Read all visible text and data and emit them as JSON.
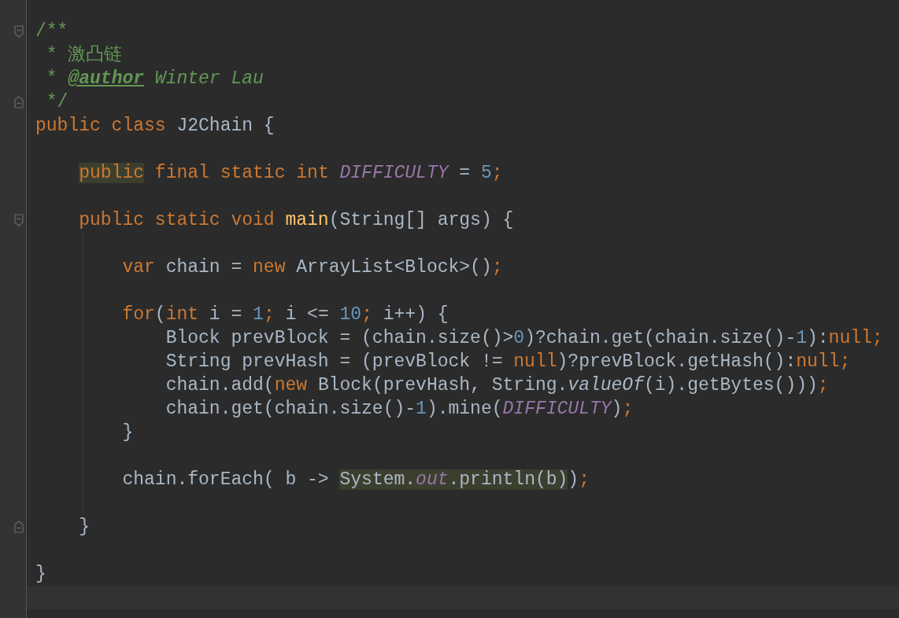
{
  "editor": {
    "current_line_highlight": true,
    "blocks": [
      {
        "lines": [
          {
            "fold_start": true,
            "tokens": [
              {
                "text": "/**",
                "kind": "comment"
              }
            ]
          },
          {
            "tokens": [
              {
                "text": " * 激凸链",
                "kind": "comment"
              }
            ]
          },
          {
            "tokens": [
              {
                "text": " * ",
                "kind": "comment"
              },
              {
                "text": "@author",
                "kind": "doctag"
              },
              {
                "text": " Winter Lau",
                "kind": "commentitalic"
              }
            ]
          },
          {
            "fold_end": true,
            "tokens": [
              {
                "text": " */",
                "kind": "comment"
              }
            ]
          },
          {
            "tokens": [
              {
                "text": "public class ",
                "kind": "keyword"
              },
              {
                "text": "J2Chain {",
                "kind": "plain"
              }
            ]
          }
        ]
      },
      {
        "lines": [
          {
            "tokens": [
              {
                "text": "    public",
                "kind": "keyword",
                "highlighted": true
              },
              {
                "text": " final static int ",
                "kind": "keyword"
              },
              {
                "text": "DIFFICULTY",
                "kind": "constant"
              },
              {
                "text": " = ",
                "kind": "plain"
              },
              {
                "text": "5",
                "kind": "number"
              },
              {
                "text": ";",
                "kind": "keyword"
              }
            ]
          }
        ]
      },
      {
        "lines": [
          {
            "fold_start": true,
            "tokens": [
              {
                "text": "    public static void ",
                "kind": "keyword"
              },
              {
                "text": "main",
                "kind": "function"
              },
              {
                "text": "(String[] args) {",
                "kind": "plain"
              }
            ]
          }
        ]
      },
      {
        "lines": [
          {
            "tokens": [
              {
                "text": "        var ",
                "kind": "keyword"
              },
              {
                "text": "chain = ",
                "kind": "plain"
              },
              {
                "text": "new ",
                "kind": "keyword"
              },
              {
                "text": "ArrayList<Block>()",
                "kind": "plain"
              },
              {
                "text": ";",
                "kind": "keyword"
              }
            ]
          }
        ]
      },
      {
        "lines": [
          {
            "tokens": [
              {
                "text": "        for",
                "kind": "keyword"
              },
              {
                "text": "(",
                "kind": "plain"
              },
              {
                "text": "int ",
                "kind": "keyword"
              },
              {
                "text": "i = ",
                "kind": "plain"
              },
              {
                "text": "1",
                "kind": "number"
              },
              {
                "text": "; ",
                "kind": "keyword"
              },
              {
                "text": "i <= ",
                "kind": "plain"
              },
              {
                "text": "10",
                "kind": "number"
              },
              {
                "text": "; ",
                "kind": "keyword"
              },
              {
                "text": "i++) {",
                "kind": "plain"
              }
            ]
          },
          {
            "tokens": [
              {
                "text": "            Block prevBlock = (chain.size()>",
                "kind": "plain"
              },
              {
                "text": "0",
                "kind": "number"
              },
              {
                "text": ")?chain.get(chain.size()-",
                "kind": "plain"
              },
              {
                "text": "1",
                "kind": "number"
              },
              {
                "text": "):",
                "kind": "plain"
              },
              {
                "text": "null;",
                "kind": "keyword"
              }
            ]
          },
          {
            "tokens": [
              {
                "text": "            String prevHash = (prevBlock != ",
                "kind": "plain"
              },
              {
                "text": "null",
                "kind": "keyword"
              },
              {
                "text": ")?prevBlock.getHash():",
                "kind": "plain"
              },
              {
                "text": "null;",
                "kind": "keyword"
              }
            ]
          },
          {
            "tokens": [
              {
                "text": "            chain.add(",
                "kind": "plain"
              },
              {
                "text": "new ",
                "kind": "keyword"
              },
              {
                "text": "Block(prevHash, String.",
                "kind": "plain"
              },
              {
                "text": "valueOf",
                "kind": "italic"
              },
              {
                "text": "(i).getBytes()))",
                "kind": "plain"
              },
              {
                "text": ";",
                "kind": "keyword"
              }
            ]
          },
          {
            "tokens": [
              {
                "text": "            chain.get(chain.size()-",
                "kind": "plain"
              },
              {
                "text": "1",
                "kind": "number"
              },
              {
                "text": ").mine(",
                "kind": "plain"
              },
              {
                "text": "DIFFICULTY",
                "kind": "constant"
              },
              {
                "text": ")",
                "kind": "plain"
              },
              {
                "text": ";",
                "kind": "keyword"
              }
            ]
          },
          {
            "tokens": [
              {
                "text": "        }",
                "kind": "plain"
              }
            ]
          }
        ]
      },
      {
        "lines": [
          {
            "tokens": [
              {
                "text": "        chain.forEach( b -> ",
                "kind": "plain"
              },
              {
                "text": "System.",
                "kind": "plain",
                "highlighted": true
              },
              {
                "text": "out",
                "kind": "constant",
                "highlighted": true
              },
              {
                "text": ".println(b)",
                "kind": "plain",
                "highlighted": true
              },
              {
                "text": ")",
                "kind": "plain"
              },
              {
                "text": ";",
                "kind": "keyword"
              }
            ]
          }
        ]
      },
      {
        "lines": [
          {
            "fold_end": true,
            "tokens": [
              {
                "text": "    }",
                "kind": "plain"
              }
            ]
          }
        ]
      },
      {
        "lines": [
          {
            "tokens": [
              {
                "text": "}",
                "kind": "plain"
              }
            ]
          }
        ]
      }
    ]
  }
}
